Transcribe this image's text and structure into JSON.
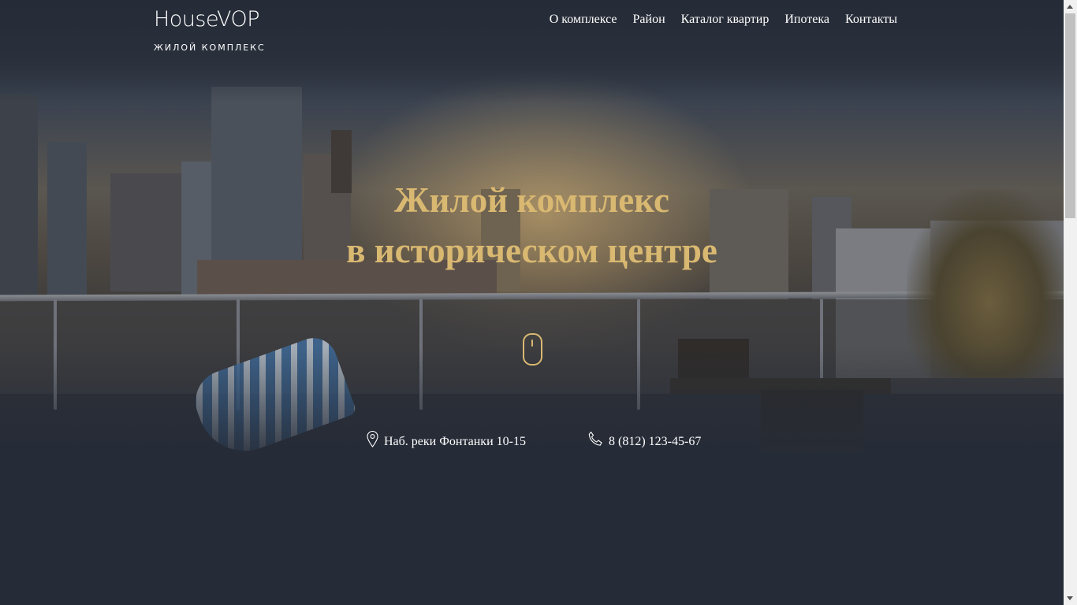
{
  "logo": {
    "brand": "HouseVOP",
    "subtitle": "ЖИЛОЙ КОМПЛЕКС"
  },
  "nav": [
    {
      "label": "О комплексе"
    },
    {
      "label": "Район"
    },
    {
      "label": "Каталог квартир"
    },
    {
      "label": "Ипотека"
    },
    {
      "label": "Контакты"
    }
  ],
  "hero": {
    "title_line1": "Жилой комплекс",
    "title_line2": "в историческом центре"
  },
  "contacts": {
    "address": "Наб. реки Фонтанки 10-15",
    "phone": "8 (812) 123-45-67"
  },
  "colors": {
    "accent": "#d9b871",
    "background": "#262c37",
    "text": "#ffffff"
  },
  "icons": {
    "scroll": "mouse-icon",
    "address": "location-pin-icon",
    "phone": "phone-icon"
  }
}
